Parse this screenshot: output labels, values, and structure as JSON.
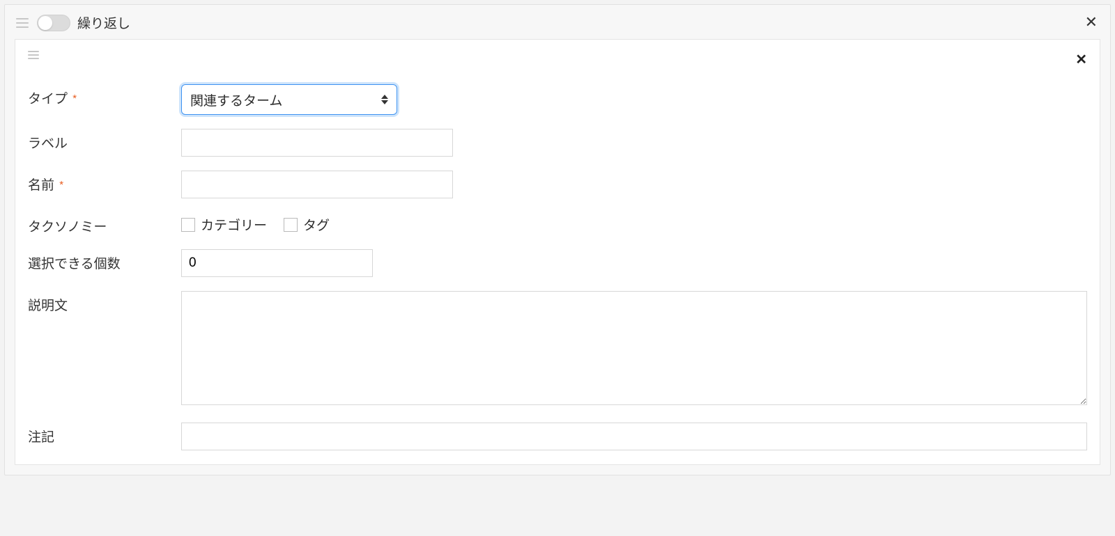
{
  "outer": {
    "toggle_label": "繰り返し",
    "toggle_state": false
  },
  "fields": {
    "type": {
      "label": "タイプ",
      "required": true,
      "value": "関連するターム"
    },
    "label": {
      "label": "ラベル",
      "value": ""
    },
    "name": {
      "label": "名前",
      "required": true,
      "value": ""
    },
    "taxonomy": {
      "label": "タクソノミー",
      "options": {
        "category": {
          "label": "カテゴリー",
          "checked": false
        },
        "tag": {
          "label": "タグ",
          "checked": false
        }
      }
    },
    "selectable_count": {
      "label": "選択できる個数",
      "value": "0"
    },
    "description": {
      "label": "説明文",
      "value": ""
    },
    "note": {
      "label": "注記",
      "value": ""
    }
  },
  "required_mark": "*"
}
